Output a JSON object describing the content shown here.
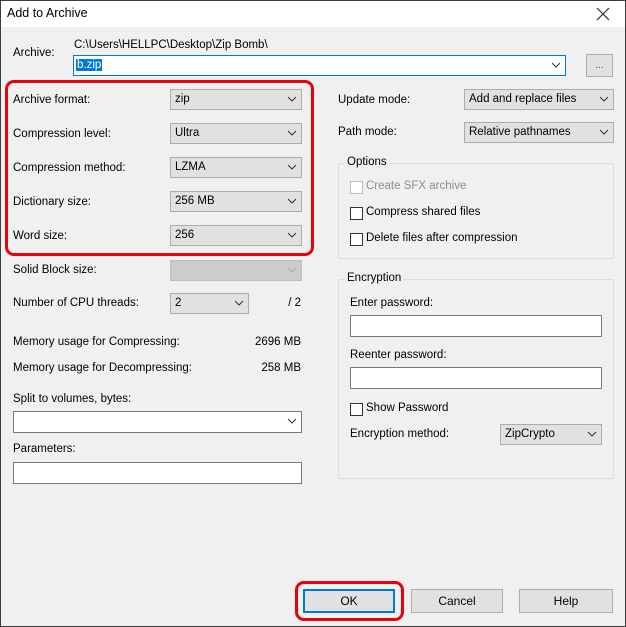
{
  "window": {
    "title": "Add to Archive",
    "close_icon": "close-icon"
  },
  "archive": {
    "label": "Archive:",
    "path": "C:\\Users\\HELLPC\\Desktop\\Zip Bomb\\",
    "filename": "b.zip",
    "browse_label": "..."
  },
  "left": {
    "archive_format": {
      "label": "Archive format:",
      "value": "zip"
    },
    "compression_level": {
      "label": "Compression level:",
      "value": "Ultra"
    },
    "compression_method": {
      "label": "Compression method:",
      "value": "LZMA"
    },
    "dictionary_size": {
      "label": "Dictionary size:",
      "value": "256 MB"
    },
    "word_size": {
      "label": "Word size:",
      "value": "256"
    },
    "solid_block_size": {
      "label": "Solid Block size:",
      "value": ""
    },
    "cpu_threads": {
      "label": "Number of CPU threads:",
      "value": "2",
      "max": "/ 2"
    },
    "mem_compress": {
      "label": "Memory usage for Compressing:",
      "value": "2696 MB"
    },
    "mem_decompress": {
      "label": "Memory usage for Decompressing:",
      "value": "258 MB"
    },
    "split_volumes": {
      "label": "Split to volumes, bytes:",
      "value": ""
    },
    "parameters": {
      "label": "Parameters:",
      "value": ""
    }
  },
  "right": {
    "update_mode": {
      "label": "Update mode:",
      "value": "Add and replace files"
    },
    "path_mode": {
      "label": "Path mode:",
      "value": "Relative pathnames"
    },
    "options": {
      "title": "Options",
      "create_sfx": {
        "label": "Create SFX archive",
        "checked": false,
        "disabled": true
      },
      "compress_shared": {
        "label": "Compress shared files",
        "checked": false
      },
      "delete_after": {
        "label": "Delete files after compression",
        "checked": false
      }
    },
    "encryption": {
      "title": "Encryption",
      "enter_password_label": "Enter password:",
      "reenter_password_label": "Reenter password:",
      "show_password_label": "Show Password",
      "method_label": "Encryption method:",
      "method_value": "ZipCrypto"
    }
  },
  "buttons": {
    "ok": "OK",
    "cancel": "Cancel",
    "help": "Help"
  },
  "colors": {
    "highlight": "#e8000b",
    "accent": "#0078d7"
  }
}
